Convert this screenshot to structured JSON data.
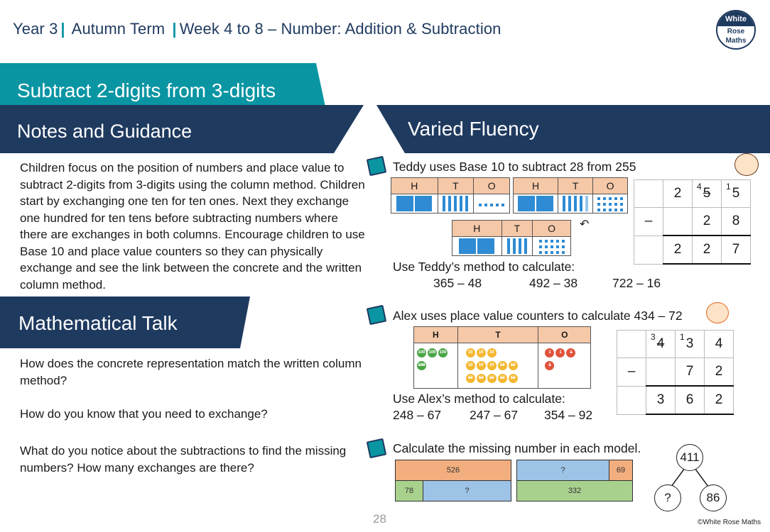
{
  "header": {
    "year": "Year 3",
    "term": "Autumn Term",
    "unit": "Week 4 to 8 – Number: Addition & Subtraction",
    "logo": [
      "White",
      "Rose",
      "Maths"
    ]
  },
  "lesson_title": "Subtract 2-digits from 3-digits",
  "notes": {
    "title": "Notes and Guidance",
    "text": "Children focus on the position of numbers and place value to subtract 2-digits from 3-digits using the column method. Children start by exchanging one ten for ten ones.  Next they exchange one hundred for ten tens before subtracting numbers where there are exchanges in both columns. Encourage children to use Base 10 and place value counters so they can physically exchange and see the link between the concrete and the written column method."
  },
  "math_talk": {
    "title": "Mathematical Talk",
    "questions": [
      "How does the concrete representation match the written column method?",
      "How do you know that you need to exchange?",
      "What do you notice about the subtractions to find the missing numbers? How many exchanges are there?"
    ]
  },
  "varied_fluency": {
    "title": "Varied Fluency",
    "q1": {
      "prompt": "Teddy uses Base 10 to subtract 28 from 255",
      "pv_headers": [
        "H",
        "T",
        "O"
      ],
      "column": {
        "row1": [
          "",
          "2",
          "5",
          "5"
        ],
        "row1_exchange": {
          "tens_new": "4",
          "ones_carry": "1"
        },
        "row2": [
          "–",
          "",
          "2",
          "8"
        ],
        "row3": [
          "",
          "2",
          "2",
          "7"
        ]
      },
      "instruction": "Use Teddy’s method to calculate:",
      "calcs": [
        "365 – 48",
        "492 – 38",
        "722 – 16"
      ]
    },
    "q2": {
      "prompt": "Alex uses place value counters to calculate 434 – 72",
      "pv_headers": [
        "H",
        "T",
        "O"
      ],
      "counter_labels": {
        "hundreds": "100",
        "tens": "10",
        "ones": "1"
      },
      "column": {
        "row1": [
          "",
          "4",
          "3",
          "4"
        ],
        "row1_exchange": {
          "hundreds_new": "3",
          "tens_carry": "1"
        },
        "row2": [
          "–",
          "",
          "7",
          "2"
        ],
        "row3": [
          "",
          "3",
          "6",
          "2"
        ]
      },
      "instruction": "Use Alex’s method to calculate:",
      "calcs": [
        "248 – 67",
        "247 – 67",
        "354 – 92"
      ]
    },
    "q3": {
      "prompt": "Calculate the missing number in each model.",
      "bar1": {
        "whole": "526",
        "parts": [
          "78",
          "?"
        ]
      },
      "bar2": {
        "parts": [
          "?",
          "69"
        ],
        "whole": "332"
      },
      "part_whole": {
        "whole": "411",
        "parts": [
          "?",
          "86"
        ]
      }
    }
  },
  "footer": {
    "page_number": "28",
    "copyright": "©White Rose Maths"
  },
  "colors": {
    "teal": "#0a95a3",
    "navy": "#1f3a5f",
    "pv_header": "#f5c8a8",
    "base10_blue": "#2e8bd4",
    "bar_orange": "#f2ae7f",
    "bar_blue": "#9dc3e6",
    "bar_green": "#a9d18e"
  }
}
